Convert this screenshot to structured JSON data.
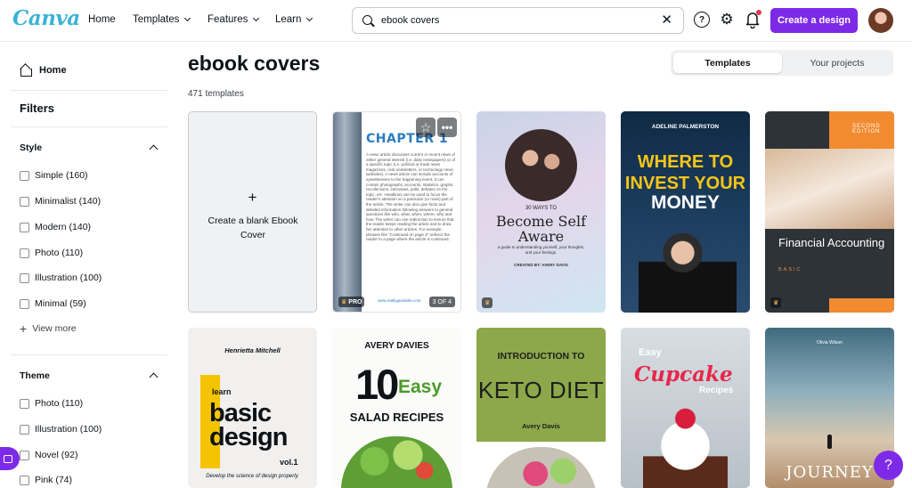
{
  "header": {
    "logo": "Canva",
    "nav": [
      "Home",
      "Templates",
      "Features",
      "Learn"
    ],
    "search_value": "ebook covers",
    "create_label": "Create a design",
    "accent": "#7d2ae8"
  },
  "sidebar": {
    "home": "Home",
    "filters": "Filters",
    "style_title": "Style",
    "style_items": [
      "Simple (160)",
      "Minimalist (140)",
      "Modern (140)",
      "Photo (110)",
      "Illustration (100)",
      "Minimal (59)"
    ],
    "view_more": "View more",
    "theme_title": "Theme",
    "theme_items": [
      "Photo (110)",
      "Illustration (100)",
      "Novel (92)",
      "Pink (74)"
    ]
  },
  "main": {
    "title": "ebook covers",
    "count": "471 templates",
    "tabs": [
      "Templates",
      "Your projects"
    ],
    "blank_plus": "+",
    "blank_label": "Create a blank Ebook Cover"
  },
  "cards": {
    "c1": {
      "title": "CHAPTER 1",
      "text": "A news article discusses current or recent news of either general interest (i.e. daily newspapers) or of a specific topic (i.e. political or trade news magazines, club newsletters, or technology news websites). A news article can include accounts of eyewitnesses to the happening event. It can contain photographs, accounts, statistics, graphs, recollections, interviews, polls, debates on the topic, etc. Headlines can be used to focus the reader's attention on a particular (or main) part of the article. The writer can also give facts and detailed information following answers to general questions like who, what, when, where, why and how. The writer can use redirection to ensure that the reader keeps reading the article and to draw her attention to other articles. For example, phrases like \"Continued on page 3\" redirect the reader to a page where the article is continued.",
      "footer": "www.reallygreatsite.com",
      "badge": "PRO",
      "pages": "3 OF 4"
    },
    "c2": {
      "small": "30 WAYS TO",
      "big": "Become Self Aware",
      "sub": "a guide to understanding yourself, your thoughts, and your feelings.",
      "author": "CREATED BY: AVERY DAVIS"
    },
    "c3": {
      "author": "ADELINE PALMERSTON",
      "line1": "WHERE TO INVEST YOUR",
      "line2": "MONEY"
    },
    "c4": {
      "edition": "SECOND EDITION",
      "title": "Financial Accounting",
      "sub": "BASIC"
    },
    "c5": {
      "author": "Henrietta Mitchell",
      "learn": "learn",
      "big": "basic design",
      "vol": "vol.1",
      "foot": "Develop the science of design properly."
    },
    "c6": {
      "author": "AVERY DAVIES",
      "num": "10",
      "easy": "Easy",
      "sub": "SALAD RECIPES"
    },
    "c7": {
      "intro": "INTRODUCTION TO",
      "big": "KETO DIET",
      "author": "Avery Davis"
    },
    "c8": {
      "easy": "Easy",
      "big": "Cupcake",
      "recipes": "Recipes"
    },
    "c9": {
      "author": "Olivia Wilson",
      "title": "JOURNEY"
    }
  },
  "icons": [
    "search-icon",
    "clear-icon",
    "help-icon",
    "gear-icon",
    "bell-icon",
    "home-icon",
    "star-icon",
    "more-icon",
    "crown-icon",
    "camera-icon"
  ],
  "fab": {
    "help": "?"
  }
}
